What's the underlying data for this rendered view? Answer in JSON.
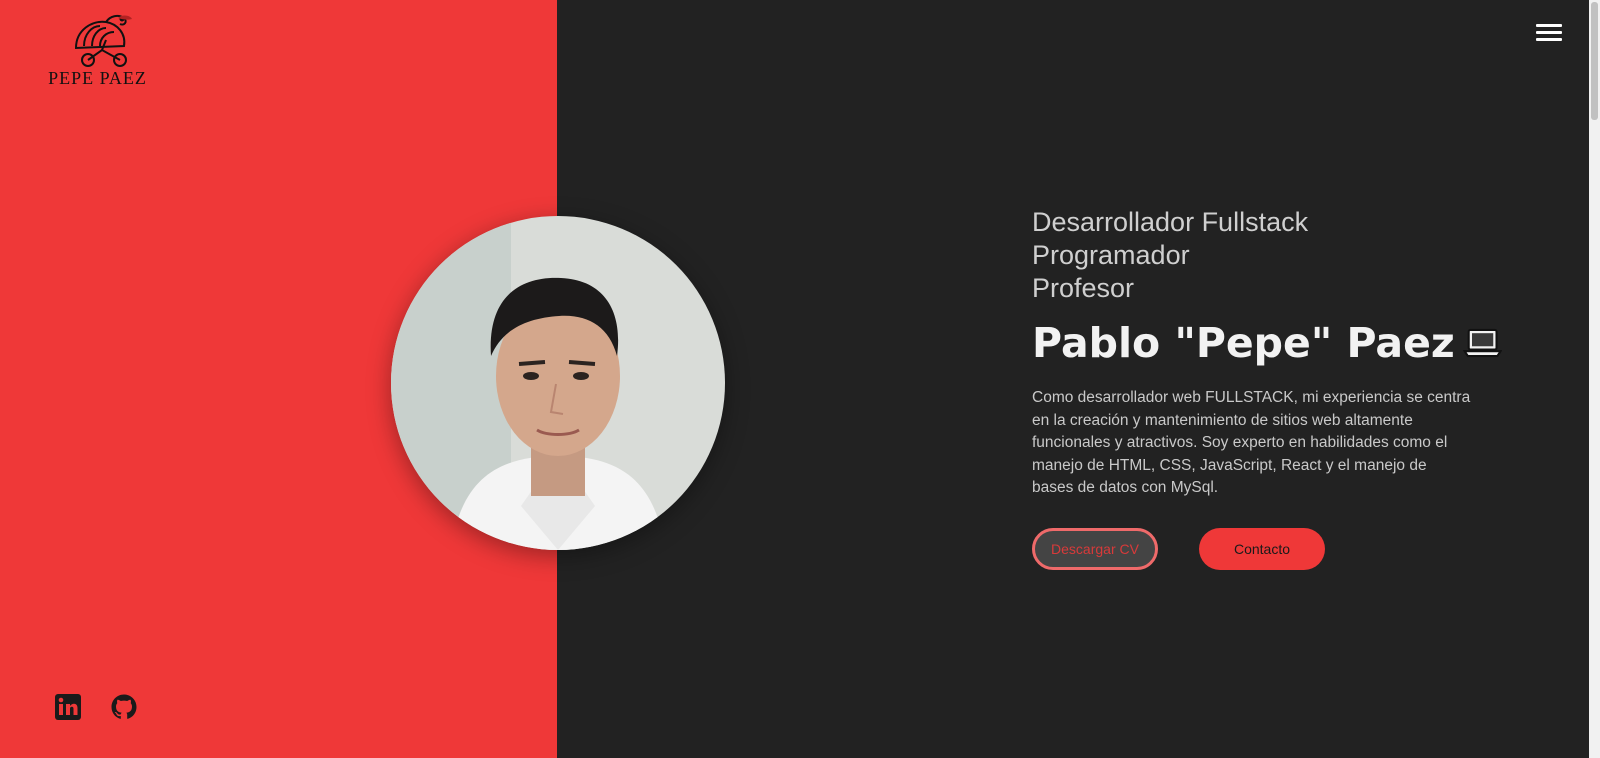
{
  "brand": {
    "logo_text": "PEPE PAEZ"
  },
  "header": {
    "menu_icon": "hamburger-menu-icon"
  },
  "hero": {
    "roles": [
      "Desarrollador Fullstack",
      "Programador",
      "Profesor"
    ],
    "name": "Pablo \"Pepe\" Paez",
    "name_emoji_icon": "laptop-icon",
    "description": "Como desarrollador web FULLSTACK, mi experiencia se centra en la creación y mantenimiento de sitios web altamente funcionales y atractivos. Soy experto en habilidades como el manejo de HTML, CSS, JavaScript, React y el manejo de bases de datos con MySql.",
    "buttons": {
      "cv_label": "Descargar CV",
      "contact_label": "Contacto"
    }
  },
  "social": {
    "items": [
      {
        "icon": "linkedin-icon"
      },
      {
        "icon": "github-icon"
      }
    ]
  },
  "colors": {
    "accent": "#ef3838",
    "background": "#222222",
    "text_light": "#f2f2f2",
    "text_muted": "#c9c9c9"
  }
}
